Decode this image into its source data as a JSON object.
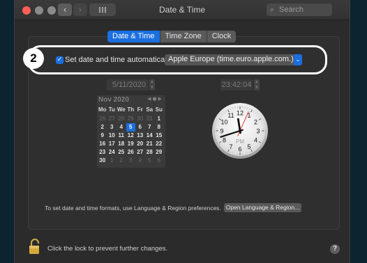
{
  "window": {
    "title": "Date & Time"
  },
  "toolbar": {
    "back_glyph": "‹",
    "forward_glyph": "›",
    "search_placeholder": "Search"
  },
  "tabs": [
    {
      "label": "Date & Time",
      "active": true
    },
    {
      "label": "Time Zone",
      "active": false
    },
    {
      "label": "Clock",
      "active": false
    }
  ],
  "callout": {
    "number": "2"
  },
  "auto_time": {
    "checked": true,
    "label": "Set date and time automatically:",
    "server": "Apple Europe (time.euro.apple.com.)"
  },
  "date_field": "5/11/2020",
  "time_field": "23:42:04",
  "calendar": {
    "month_label": "Nov 2020",
    "days_of_week": [
      "Mo",
      "Tu",
      "We",
      "Th",
      "Fr",
      "Sa",
      "Su"
    ],
    "weeks": [
      [
        "26",
        "27",
        "28",
        "29",
        "30",
        "31",
        "1"
      ],
      [
        "2",
        "3",
        "4",
        "5",
        "6",
        "7",
        "8"
      ],
      [
        "9",
        "10",
        "11",
        "12",
        "13",
        "14",
        "15"
      ],
      [
        "16",
        "17",
        "18",
        "19",
        "20",
        "21",
        "22"
      ],
      [
        "23",
        "24",
        "25",
        "26",
        "27",
        "28",
        "29"
      ],
      [
        "30",
        "1",
        "2",
        "3",
        "4",
        "5",
        "6"
      ]
    ],
    "selected_day": "5"
  },
  "clock": {
    "numbers": [
      "12",
      "1",
      "2",
      "3",
      "4",
      "5",
      "6",
      "7",
      "8",
      "9",
      "10",
      "11"
    ],
    "period": "PM",
    "hour": 11,
    "minute": 42,
    "second": 4
  },
  "footer": {
    "note": "To set date and time formats, use Language & Region preferences.",
    "button": "Open Language & Region..."
  },
  "lock": {
    "text": "Click the lock to prevent further changes."
  },
  "help": {
    "label": "?"
  },
  "colors": {
    "accent": "#1b6fe0",
    "close_button": "#fe5f57",
    "second_hand": "#e2362d"
  }
}
